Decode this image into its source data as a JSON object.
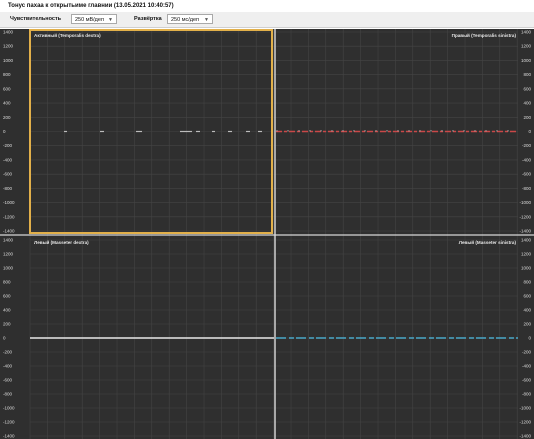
{
  "window": {
    "title": "Тонус пахаа к открытьиме главнии (13.05.2021 10:40:57)"
  },
  "toolbar": {
    "sensitivity_label": "Чувствительность",
    "sensitivity_value": "250 мВ/деп",
    "gain_label": "Развёртка",
    "gain_value": "250 мс/деп"
  },
  "panels": {
    "top_left": "Активный (Temporalis dextra)",
    "top_right": "Правый (Temporalis sinistra)",
    "bottom_left": "Левый (Masseter dextra)",
    "bottom_right": "Левый (Masseter sinistra)"
  },
  "y_axis": {
    "top_ticks": [
      "1400",
      "1200",
      "1000",
      "800",
      "600",
      "400",
      "200",
      "0",
      "-200",
      "-400",
      "-600",
      "-800",
      "-1000",
      "-1200",
      "-1400"
    ],
    "bottom_ticks": [
      "1400",
      "1200",
      "1000",
      "800",
      "600",
      "400",
      "200",
      "0",
      "-200",
      "-400",
      "-600",
      "-800",
      "-1000",
      "-1200",
      "-1400"
    ]
  },
  "colors": {
    "background": "#2f2f2f",
    "grid": "#444444",
    "selection": "#e2b04a",
    "trace_top_right": "#c94848",
    "trace_bottom_right": "#4aa8c9",
    "trace_left": "#bcbcbc",
    "cursor": "#d0d0d0"
  }
}
